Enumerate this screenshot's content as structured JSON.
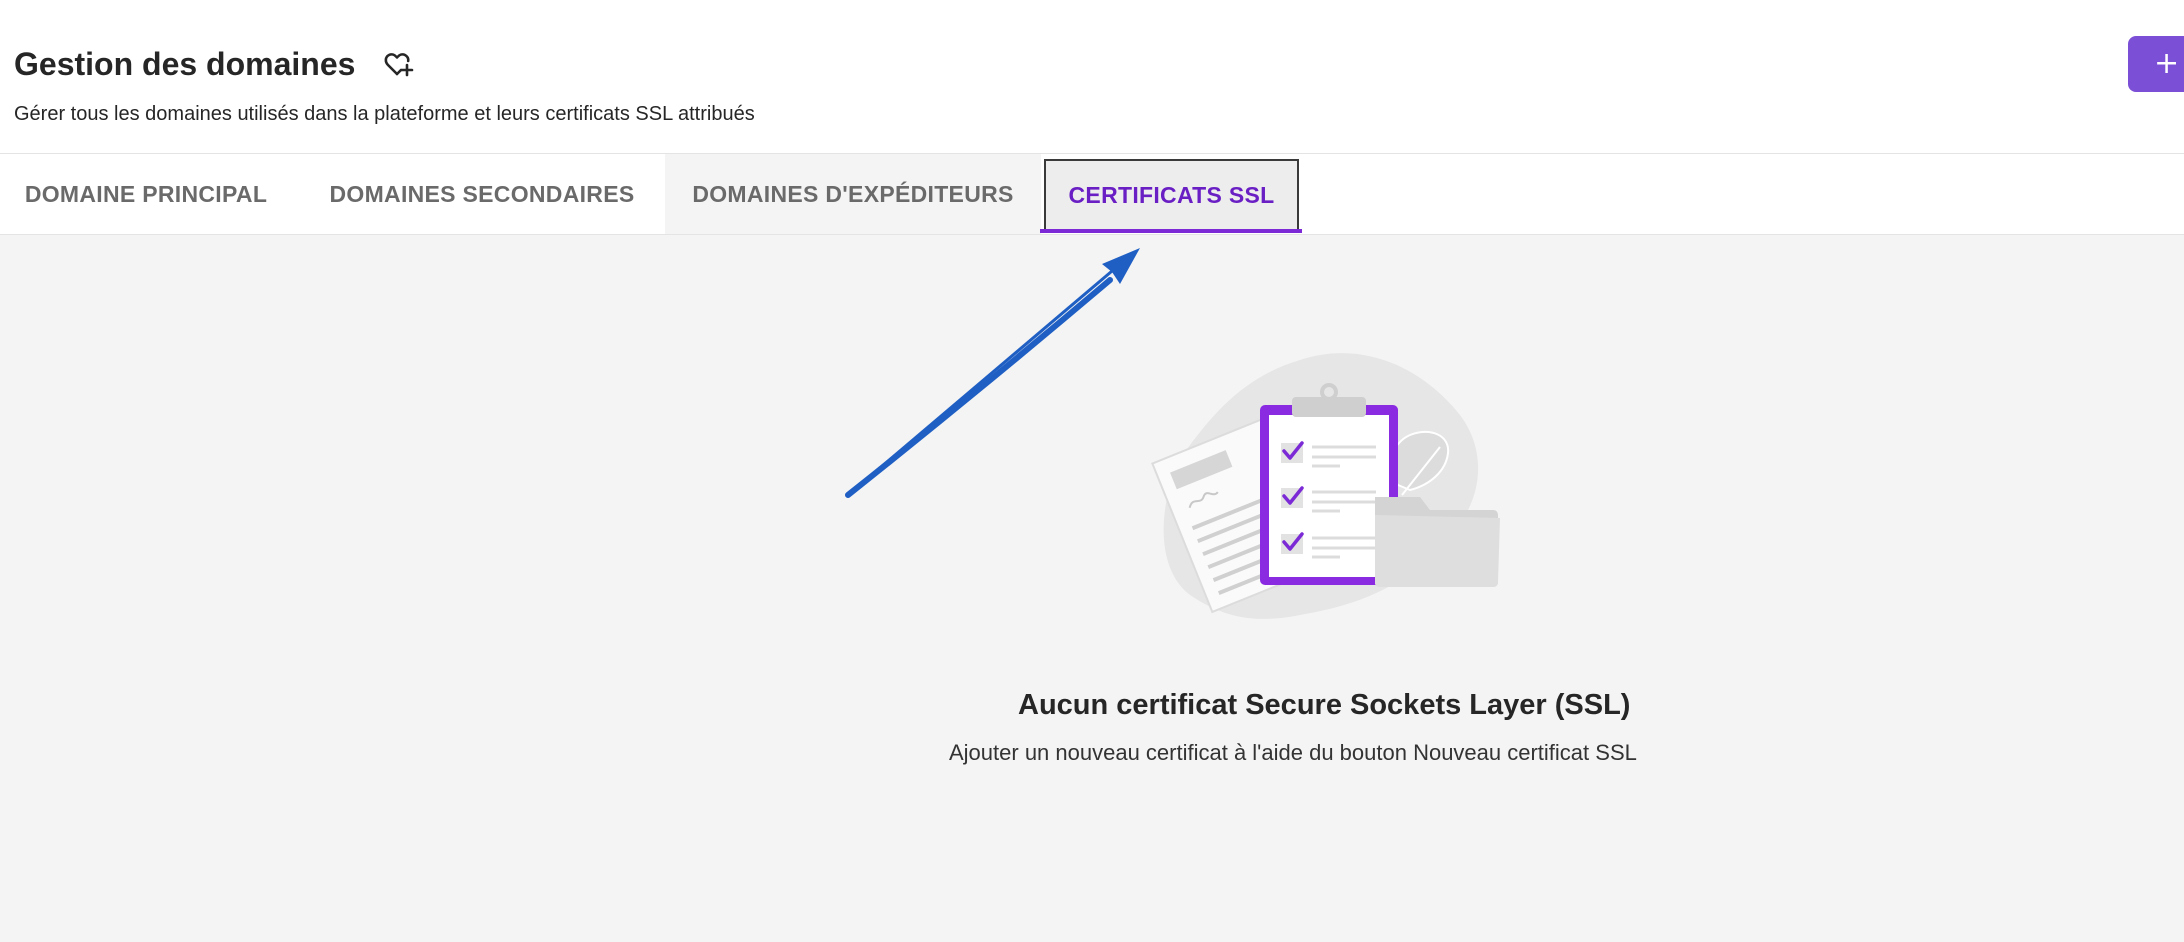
{
  "header": {
    "title": "Gestion des domaines",
    "subtitle": "Gérer tous les domaines utilisés dans la plateforme et leurs certificats SSL attribués",
    "favorite_icon": "heart-plus-icon",
    "add_button_icon": "plus-icon",
    "add_button_label": "+"
  },
  "tabs": [
    {
      "label": "DOMAINE PRINCIPAL",
      "active": false
    },
    {
      "label": "DOMAINES SECONDAIRES",
      "active": false
    },
    {
      "label": "DOMAINES D'EXPÉDITEURS",
      "active": false
    },
    {
      "label": "CERTIFICATS SSL",
      "active": true
    }
  ],
  "empty_state": {
    "illustration": "clipboard-checklist-document-folder-illustration",
    "title": "Aucun certificat Secure Sockets Layer (SSL)",
    "message": "Ajouter un nouveau certificat à l'aide du bouton Nouveau certificat SSL"
  },
  "annotation": {
    "arrow_icon": "annotation-arrow",
    "arrow_color": "#1f5fc4"
  },
  "colors": {
    "accent": "#7b4fd6",
    "active_tab_text": "#6a1fc4",
    "content_background": "#f4f4f4"
  }
}
